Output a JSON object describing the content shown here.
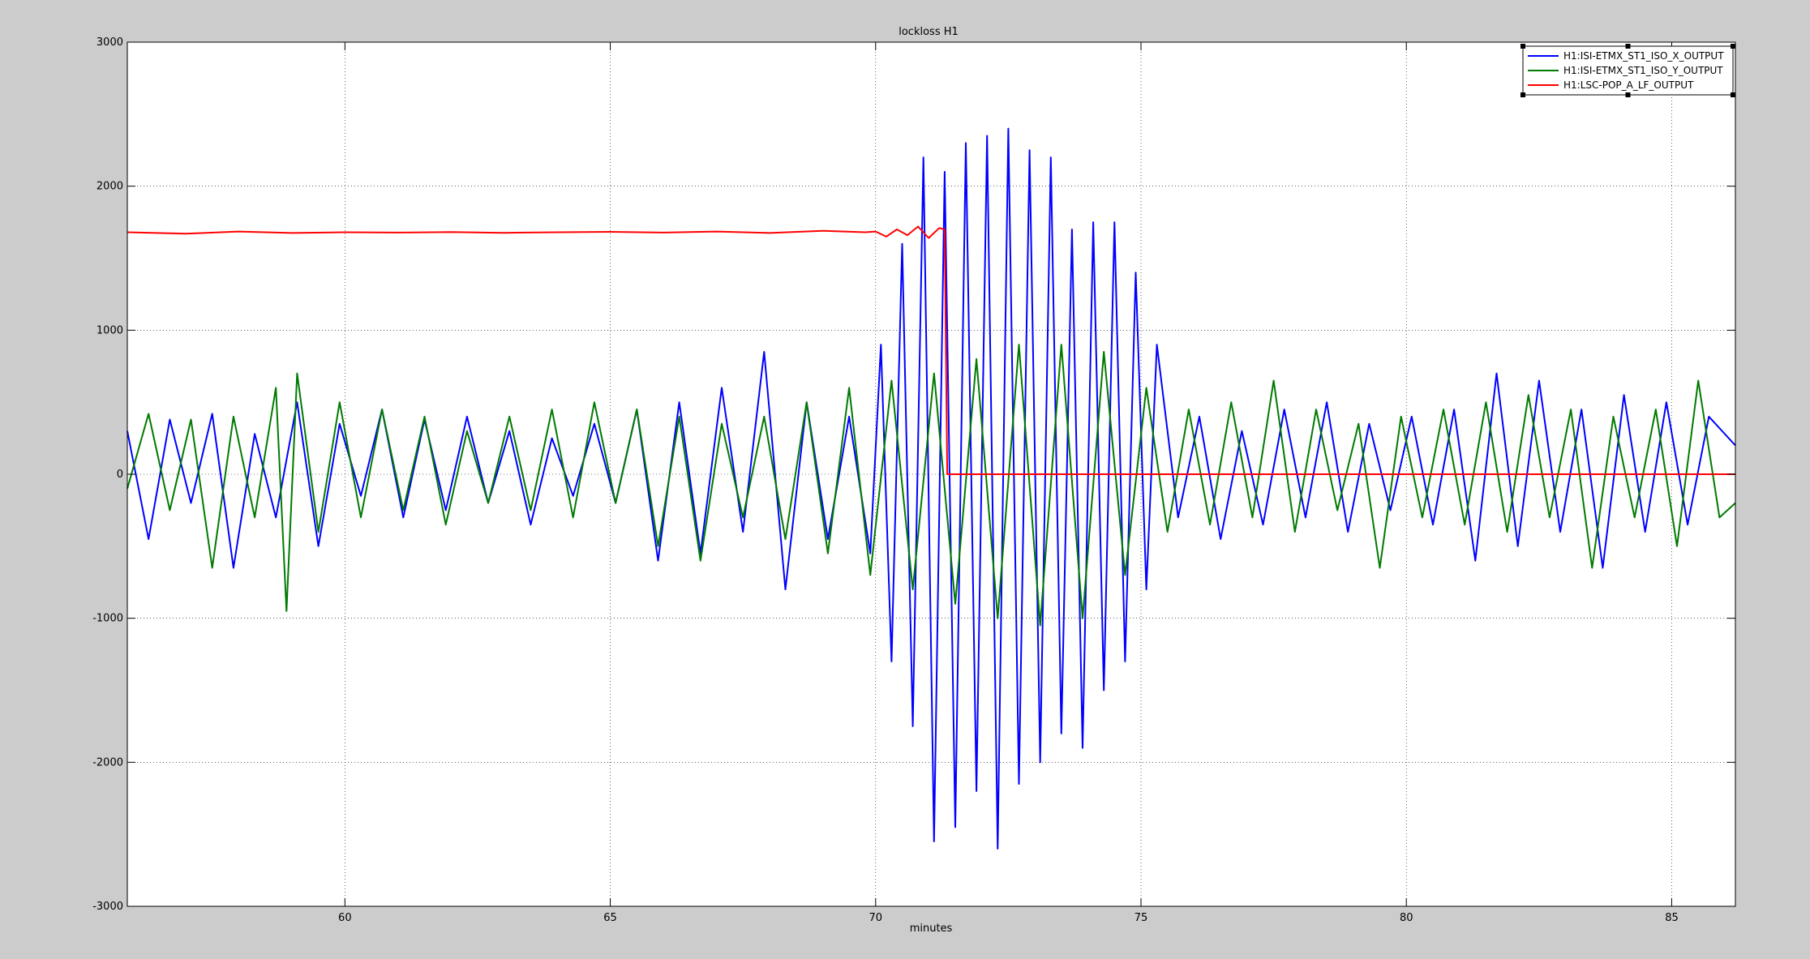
{
  "chart_data": {
    "type": "line",
    "title": "lockloss H1",
    "xlabel": "minutes",
    "ylabel": "",
    "xlim": [
      55.9,
      86.2
    ],
    "ylim": [
      -3000,
      3000
    ],
    "grid": true,
    "legend_position": "top-right",
    "x_ticks": [
      60,
      65,
      70,
      75,
      80,
      85
    ],
    "x_tick_labels": [
      "60",
      "65",
      "70",
      "75",
      "80",
      "85"
    ],
    "y_ticks": [
      3000,
      2000,
      1000,
      0,
      -1000,
      -2000,
      -3000
    ],
    "y_tick_labels": [
      "3000",
      "2000",
      "1000",
      "0",
      "-1000",
      "-2000",
      "-3000"
    ],
    "series": [
      {
        "name": "H1:ISI-ETMX_ST1_ISO_X_OUTPUT",
        "color": "#0000ff",
        "x": [
          55.9,
          56.3,
          56.7,
          57.1,
          57.5,
          57.9,
          58.3,
          58.7,
          59.1,
          59.5,
          59.9,
          60.3,
          60.7,
          61.1,
          61.5,
          61.9,
          62.3,
          62.7,
          63.1,
          63.5,
          63.9,
          64.3,
          64.7,
          65.1,
          65.5,
          65.9,
          66.3,
          66.7,
          67.1,
          67.5,
          67.9,
          68.3,
          68.7,
          69.1,
          69.5,
          69.9,
          70.1,
          70.3,
          70.5,
          70.7,
          70.9,
          71.1,
          71.3,
          71.5,
          71.7,
          71.9,
          72.1,
          72.3,
          72.5,
          72.7,
          72.9,
          73.1,
          73.3,
          73.5,
          73.7,
          73.9,
          74.1,
          74.3,
          74.5,
          74.7,
          74.9,
          75.1,
          75.3,
          75.7,
          76.1,
          76.5,
          76.9,
          77.3,
          77.7,
          78.1,
          78.5,
          78.9,
          79.3,
          79.7,
          80.1,
          80.5,
          80.9,
          81.3,
          81.7,
          82.1,
          82.5,
          82.9,
          83.3,
          83.7,
          84.1,
          84.5,
          84.9,
          85.3,
          85.7,
          86.2
        ],
        "y": [
          300,
          -450,
          380,
          -200,
          420,
          -650,
          280,
          -300,
          500,
          -500,
          350,
          -150,
          450,
          -300,
          380,
          -250,
          400,
          -200,
          300,
          -350,
          250,
          -150,
          350,
          -200,
          450,
          -600,
          500,
          -550,
          600,
          -400,
          850,
          -800,
          500,
          -450,
          400,
          -550,
          900,
          -1300,
          1600,
          -1750,
          2200,
          -2550,
          2100,
          -2450,
          2300,
          -2200,
          2350,
          -2600,
          2400,
          -2150,
          2250,
          -2000,
          2200,
          -1800,
          1700,
          -1900,
          1750,
          -1500,
          1750,
          -1300,
          1400,
          -800,
          900,
          -300,
          400,
          -450,
          300,
          -350,
          450,
          -300,
          500,
          -400,
          350,
          -250,
          400,
          -350,
          450,
          -600,
          700,
          -500,
          650,
          -400,
          450,
          -650,
          550,
          -400,
          500,
          -350,
          400,
          200
        ]
      },
      {
        "name": "H1:ISI-ETMX_ST1_ISO_Y_OUTPUT",
        "color": "#007a00",
        "x": [
          55.9,
          56.3,
          56.7,
          57.1,
          57.5,
          57.9,
          58.3,
          58.7,
          58.9,
          59.1,
          59.5,
          59.9,
          60.3,
          60.7,
          61.1,
          61.5,
          61.9,
          62.3,
          62.7,
          63.1,
          63.5,
          63.9,
          64.3,
          64.7,
          65.1,
          65.5,
          65.9,
          66.3,
          66.7,
          67.1,
          67.5,
          67.9,
          68.3,
          68.7,
          69.1,
          69.5,
          69.9,
          70.3,
          70.7,
          71.1,
          71.5,
          71.9,
          72.3,
          72.7,
          73.1,
          73.5,
          73.9,
          74.3,
          74.7,
          75.1,
          75.5,
          75.9,
          76.3,
          76.7,
          77.1,
          77.5,
          77.9,
          78.3,
          78.7,
          79.1,
          79.5,
          79.9,
          80.3,
          80.7,
          81.1,
          81.5,
          81.9,
          82.3,
          82.7,
          83.1,
          83.5,
          83.9,
          84.3,
          84.7,
          85.1,
          85.5,
          85.9,
          86.2
        ],
        "y": [
          -100,
          420,
          -250,
          380,
          -650,
          400,
          -300,
          600,
          -950,
          700,
          -400,
          500,
          -300,
          450,
          -250,
          400,
          -350,
          300,
          -200,
          400,
          -250,
          450,
          -300,
          500,
          -200,
          450,
          -500,
          400,
          -600,
          350,
          -300,
          400,
          -450,
          500,
          -550,
          600,
          -700,
          650,
          -800,
          700,
          -900,
          800,
          -1000,
          900,
          -1050,
          900,
          -1000,
          850,
          -700,
          600,
          -400,
          450,
          -350,
          500,
          -300,
          650,
          -400,
          450,
          -250,
          350,
          -650,
          400,
          -300,
          450,
          -350,
          500,
          -400,
          550,
          -300,
          450,
          -650,
          400,
          -300,
          450,
          -500,
          650,
          -300,
          -200
        ]
      },
      {
        "name": "H1:LSC-POP_A_LF_OUTPUT",
        "color": "#ff0000",
        "x": [
          55.9,
          57.0,
          58.0,
          59.0,
          60.0,
          61.0,
          62.0,
          63.0,
          64.0,
          65.0,
          66.0,
          67.0,
          68.0,
          69.0,
          69.8,
          70.0,
          70.2,
          70.4,
          70.6,
          70.8,
          71.0,
          71.2,
          71.3,
          71.35,
          72.0,
          75.0,
          80.0,
          86.2
        ],
        "y": [
          1680,
          1670,
          1685,
          1675,
          1680,
          1678,
          1682,
          1676,
          1680,
          1683,
          1678,
          1685,
          1675,
          1690,
          1680,
          1685,
          1650,
          1700,
          1660,
          1720,
          1640,
          1710,
          1700,
          0,
          0,
          0,
          0,
          0
        ]
      }
    ]
  }
}
